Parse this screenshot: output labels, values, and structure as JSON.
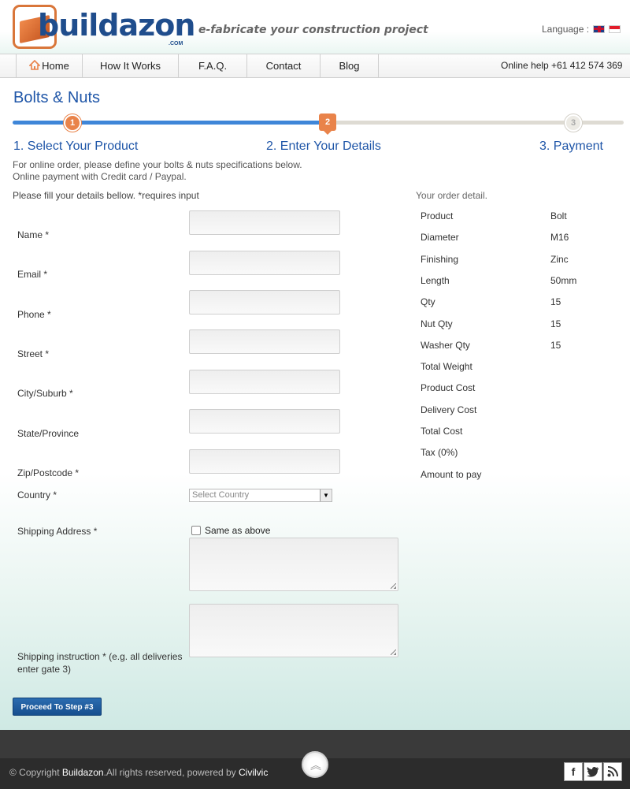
{
  "header": {
    "brand": "buildazon",
    "brand_suffix": ".COM",
    "tagline": "e-fabricate your construction project",
    "language_label": "Language :"
  },
  "nav": {
    "items": [
      "Home",
      "How It Works",
      "F.A.Q.",
      "Contact",
      "Blog"
    ],
    "online_help": "Online help +61 412 574 369"
  },
  "page": {
    "title": "Bolts & Nuts",
    "steps": [
      {
        "number": "1",
        "label": "1. Select Your Product"
      },
      {
        "number": "2",
        "label": "2. Enter Your Details"
      },
      {
        "number": "3",
        "label": "3. Payment"
      }
    ],
    "intro_line1": "For online order, please define your bolts & nuts specifications below.",
    "intro_line2": "Online payment with Credit card / Paypal."
  },
  "form": {
    "hint": "Please fill your details bellow. *requires input",
    "fields": {
      "name": "Name *",
      "email": "Email *",
      "phone": "Phone *",
      "street": "Street *",
      "city": "City/Suburb *",
      "state": "State/Province",
      "zip": "Zip/Postcode *",
      "country": "Country *",
      "shipping": "Shipping Address *",
      "instruction_line1": "Shipping instruction * (e.g. all deliveries",
      "instruction_line2": "enter gate 3)"
    },
    "country_select": "Select Country",
    "same_as_above": "Same as above",
    "proceed_button": "Proceed To Step #3"
  },
  "order": {
    "title": "Your order detail.",
    "rows": [
      {
        "key": "Product",
        "value": "Bolt"
      },
      {
        "key": "Diameter",
        "value": "M16"
      },
      {
        "key": "Finishing",
        "value": "Zinc"
      },
      {
        "key": "Length",
        "value": "50mm"
      },
      {
        "key": "Qty",
        "value": "15"
      },
      {
        "key": "Nut Qty",
        "value": "15"
      },
      {
        "key": "Washer Qty",
        "value": "15"
      },
      {
        "key": "Total Weight",
        "value": ""
      },
      {
        "key": "Product Cost",
        "value": ""
      },
      {
        "key": "Delivery Cost",
        "value": ""
      },
      {
        "key": "Total Cost",
        "value": ""
      },
      {
        "key": "Tax (0%)",
        "value": ""
      },
      {
        "key": "Amount to pay",
        "value": ""
      }
    ]
  },
  "footer": {
    "copyright_prefix": "© Copyright ",
    "copyright_brand": "Buildazon",
    "copyright_suffix": ".All rights reserved, powered by ",
    "powered_by": "Civilvic",
    "social": [
      "f",
      "t",
      "rss"
    ]
  },
  "colors": {
    "accent_blue": "#1f56a8",
    "progress_blue": "#3f86d8",
    "step_orange": "#e9834a",
    "button_blue": "#174f8e",
    "footer_dark": "#2c2c2c"
  }
}
